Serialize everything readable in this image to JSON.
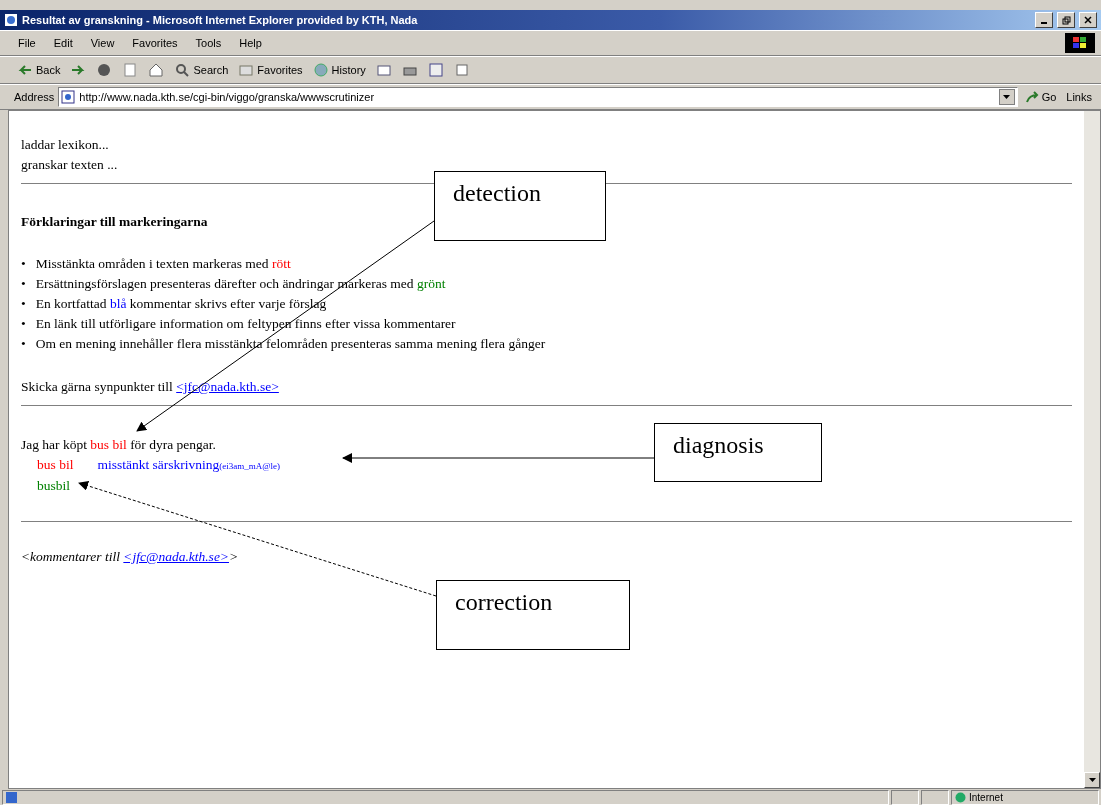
{
  "window": {
    "title": "Resultat av granskning - Microsoft Internet Explorer provided by KTH, Nada"
  },
  "menu": [
    "File",
    "Edit",
    "View",
    "Favorites",
    "Tools",
    "Help"
  ],
  "toolbar": [
    {
      "kind": "back",
      "label": "Back"
    },
    {
      "kind": "forward"
    },
    {
      "kind": "stop"
    },
    {
      "kind": "refresh"
    },
    {
      "kind": "home"
    },
    {
      "kind": "search",
      "label": "Search"
    },
    {
      "kind": "favorites",
      "label": "Favorites"
    },
    {
      "kind": "history",
      "label": "History"
    },
    {
      "kind": "mail"
    },
    {
      "kind": "print"
    },
    {
      "kind": "edit"
    },
    {
      "kind": "discuss"
    }
  ],
  "address": {
    "label": "Address",
    "value": "http://www.nada.kth.se/cgi-bin/viggo/granska/wwwscrutinizer",
    "go": "Go",
    "links": "Links"
  },
  "page": {
    "progress": [
      "laddar lexikon...",
      "granskar texten ..."
    ],
    "heading": "Förklaringar till markeringarna",
    "bullets": [
      {
        "marker": "•",
        "segments": [
          {
            "text": "Misstänkta områden i texten markeras med "
          },
          {
            "text": "rött",
            "color": "#ff0000"
          }
        ]
      },
      {
        "marker": "•",
        "segments": [
          {
            "text": "Ersättningsförslagen presenteras därefter och ändringar markeras med "
          },
          {
            "text": "grönt",
            "color": "#008000"
          }
        ]
      },
      {
        "marker": "•",
        "segments": [
          {
            "text": "En kortfattad "
          },
          {
            "text": "blå",
            "color": "#0000ff"
          },
          {
            "text": " kommentar skrivs efter varje förslag"
          }
        ]
      },
      {
        "marker": "•",
        "segments": [
          {
            "text": "En länk till utförligare information om feltypen finns efter vissa kommentarer"
          }
        ]
      },
      {
        "marker": "•",
        "segments": [
          {
            "text": "Om en mening innehåller flera misstänkta felområden presenteras samma mening flera gånger"
          }
        ]
      }
    ],
    "contact": {
      "text": "Skicka gärna synpunkter till ",
      "link": "<jfc@nada.kth.se>"
    },
    "sentence": [
      {
        "text": "Jag har köpt "
      },
      {
        "text": "bus bil",
        "color": "#ff0000"
      },
      {
        "text": " för dyra pengar."
      }
    ],
    "error": {
      "span": "bus bil",
      "comment": "misstänkt särskrivning",
      "code": "(ei3am_mA@le)"
    },
    "correction": "busbil",
    "comments": {
      "text": "<kommentarer till ",
      "link": "<jfc@nada.kth.se>",
      "end": ">"
    }
  },
  "annotations": [
    {
      "kind": "detection",
      "label": "detection"
    },
    {
      "kind": "diagnosis",
      "label": "diagnosis"
    },
    {
      "kind": "correction",
      "label": "correction"
    }
  ],
  "status_bar": {
    "zone": "Internet"
  }
}
